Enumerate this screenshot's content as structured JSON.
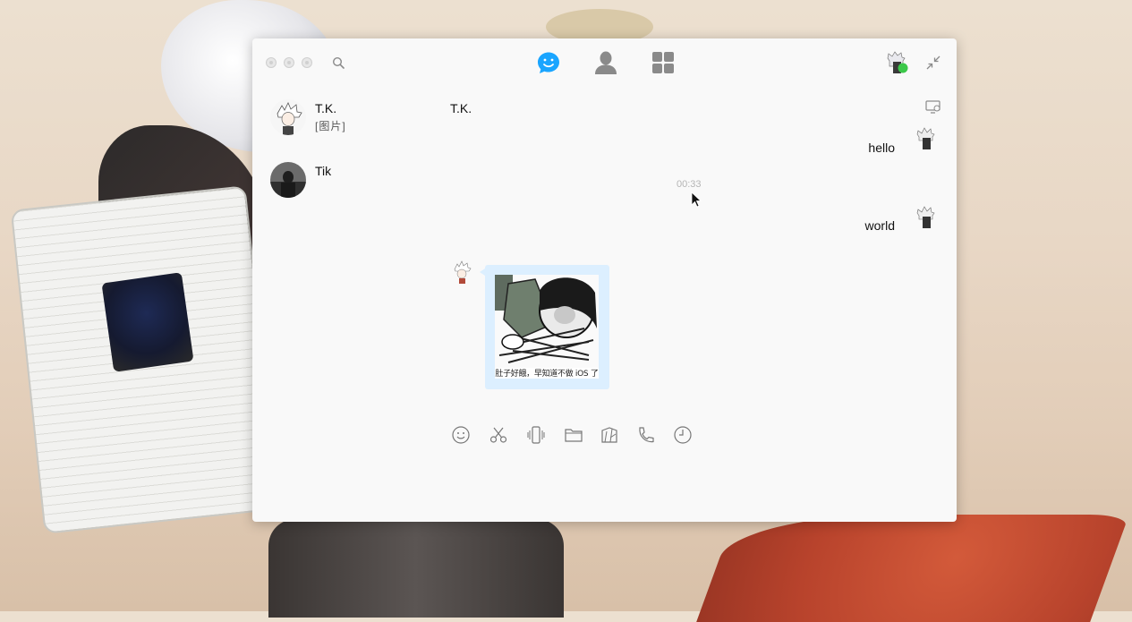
{
  "window": {
    "nav_tabs": [
      {
        "name": "chats",
        "icon": "chat-bubble-icon",
        "active": true
      },
      {
        "name": "contacts",
        "icon": "person-icon",
        "active": false
      },
      {
        "name": "apps",
        "icon": "grid-icon",
        "active": false
      }
    ],
    "accent_color": "#1aa5ff",
    "online_status_color": "#3cc84a"
  },
  "contacts": [
    {
      "name": "T.K.",
      "preview": "[图片]"
    },
    {
      "name": "Tik",
      "preview": ""
    }
  ],
  "chat": {
    "title": "T.K.",
    "messages": [
      {
        "type": "text",
        "direction": "outgoing",
        "text": "hello"
      },
      {
        "type": "timestamp",
        "text": "00:33"
      },
      {
        "type": "text",
        "direction": "outgoing",
        "text": "world"
      },
      {
        "type": "image",
        "direction": "incoming",
        "caption": "肚子好餓，早知道不做 iOS 了"
      }
    ]
  },
  "toolbar": {
    "items": [
      "emoji-icon",
      "scissors-icon",
      "shake-icon",
      "folder-icon",
      "sticker-icon",
      "phone-icon",
      "history-icon"
    ]
  }
}
